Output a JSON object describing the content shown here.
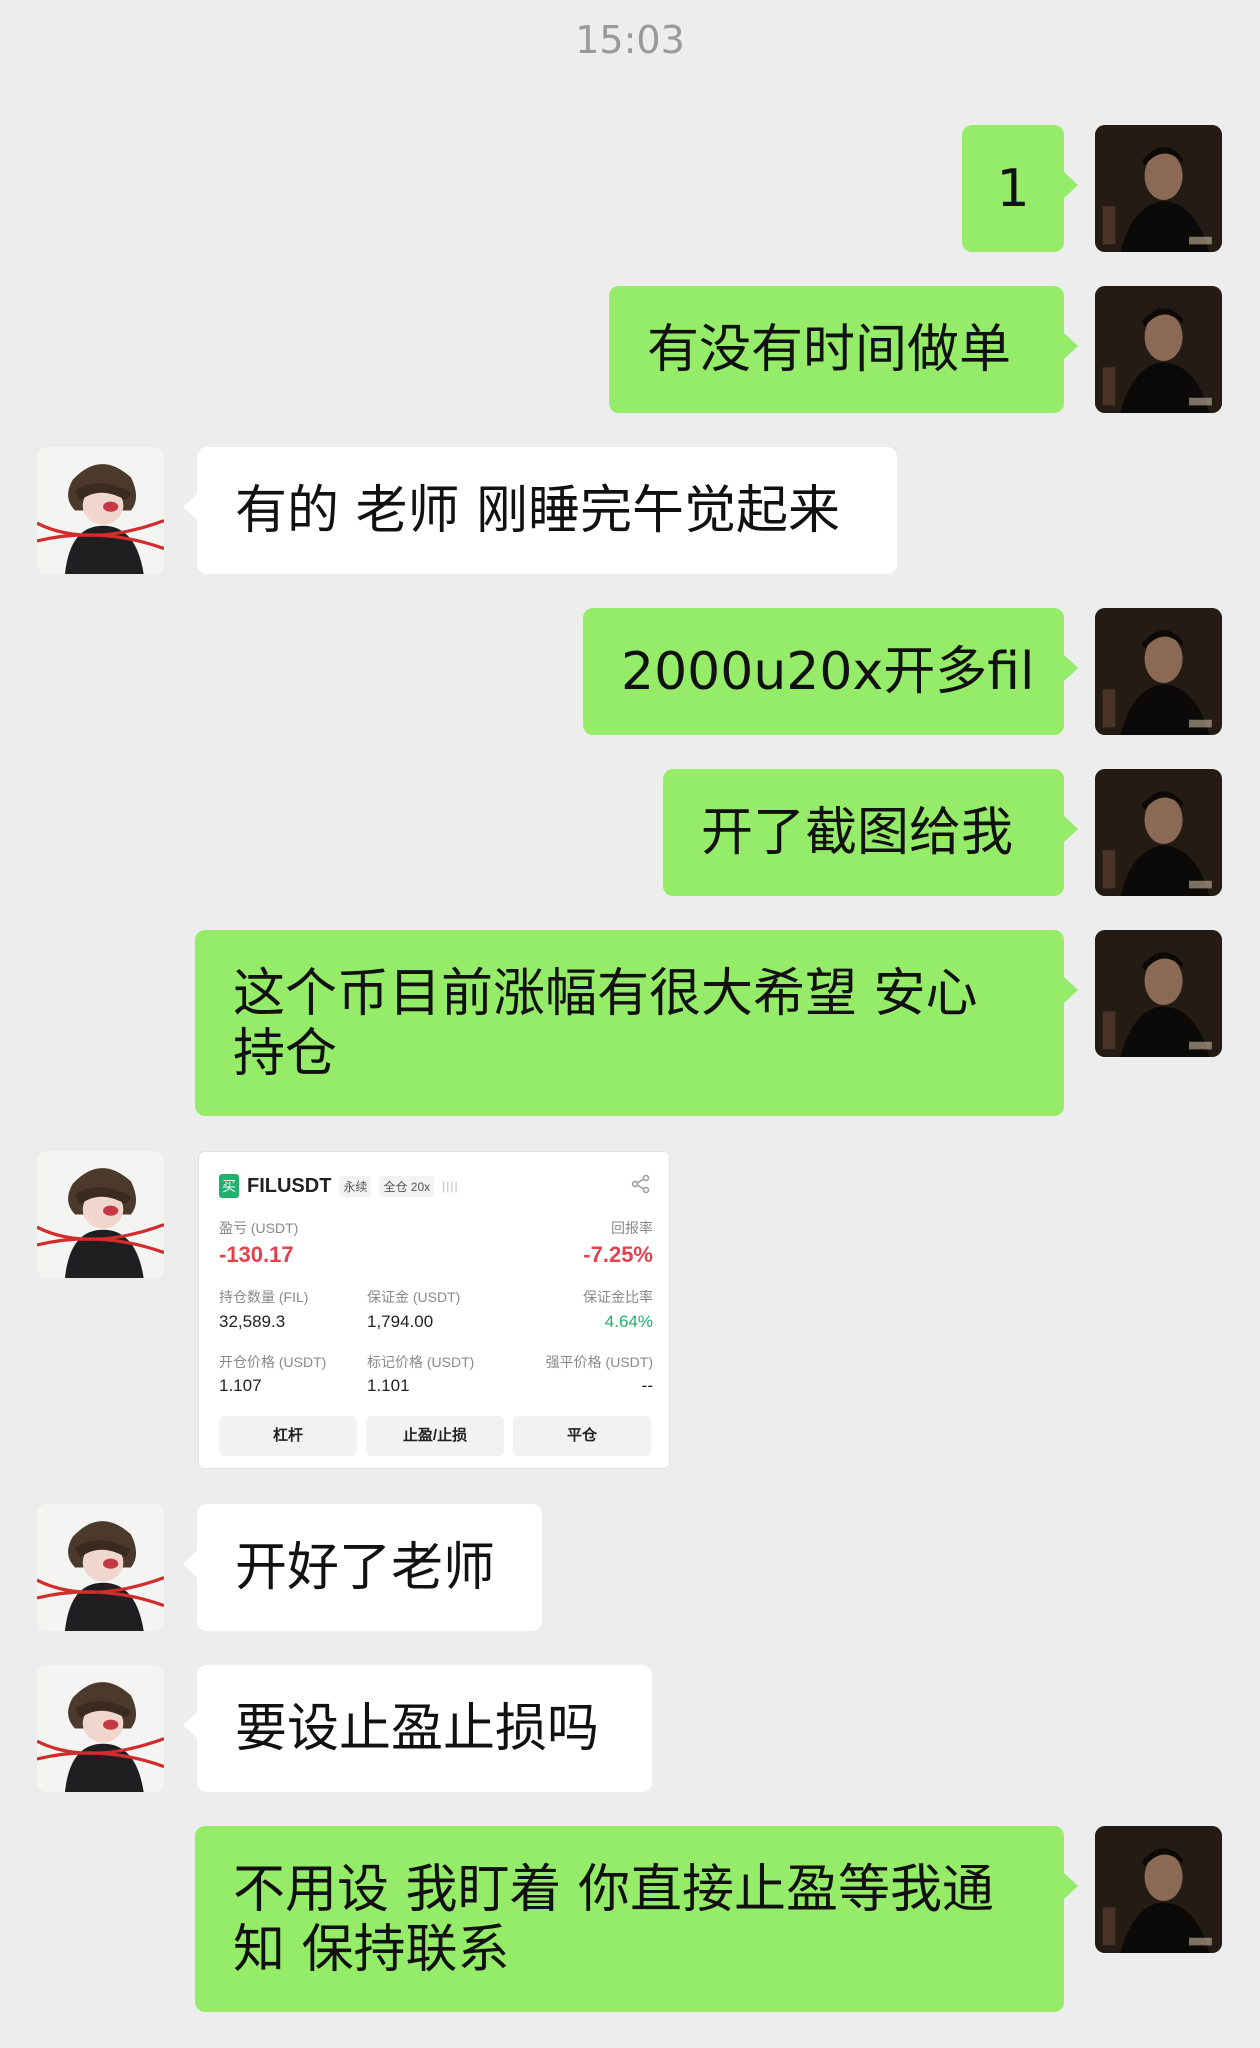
{
  "time": "15:03",
  "messages": [
    {
      "from": "me",
      "text": "1"
    },
    {
      "from": "me",
      "text": "有没有时间做单"
    },
    {
      "from": "them",
      "text": "有的 老师 刚睡完午觉起来"
    },
    {
      "from": "me",
      "text": "2000u20x开多fil"
    },
    {
      "from": "me",
      "text": "开了截图给我"
    },
    {
      "from": "me",
      "text": "这个币目前涨幅有很大希望 安心持仓"
    },
    {
      "from": "them",
      "type": "image"
    },
    {
      "from": "them",
      "text": "开好了老师"
    },
    {
      "from": "them",
      "text": "要设止盈止损吗"
    },
    {
      "from": "me",
      "text": "不用设 我盯着 你直接止盈等我通知 保持联系"
    }
  ],
  "trade_card": {
    "badge": "买",
    "pair": "FILUSDT",
    "tag_perpetual": "永续",
    "tag_margin": "全仓 20x",
    "bars": "||||",
    "pnl_label": "盈亏 (USDT)",
    "pnl_value": "-130.17",
    "roe_label": "回报率",
    "roe_value": "-7.25%",
    "position_label": "持仓数量 (FIL)",
    "position_value": "32,589.3",
    "margin_label": "保证金 (USDT)",
    "margin_value": "1,794.00",
    "margin_ratio_label": "保证金比率",
    "margin_ratio_value": "4.64%",
    "entry_label": "开仓价格 (USDT)",
    "entry_value": "1.107",
    "mark_label": "标记价格 (USDT)",
    "mark_value": "1.101",
    "liq_label": "强平价格 (USDT)",
    "liq_value": "--",
    "buttons": [
      "杠杆",
      "止盈/止损",
      "平仓"
    ]
  },
  "colors": {
    "outgoing_bubble": "#95ec69",
    "incoming_bubble": "#ffffff",
    "background": "#ededed",
    "loss_red": "#e2424e",
    "profit_green": "#20b26c"
  }
}
